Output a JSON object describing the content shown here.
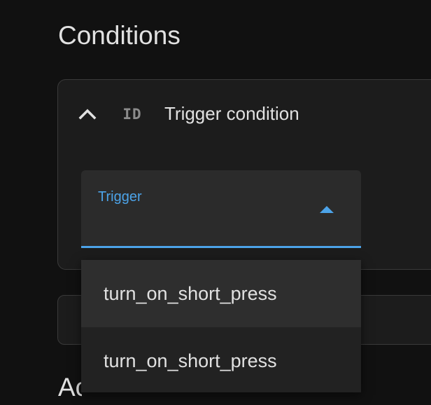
{
  "section": {
    "title": "Conditions",
    "next_title": "Actions"
  },
  "condition": {
    "collapse_icon": "chevron-up-icon",
    "type_icon": "id-icon",
    "type_icon_text": "ID",
    "title": "Trigger condition"
  },
  "trigger_select": {
    "label": "Trigger",
    "value": "",
    "arrow_icon": "triangle-up-icon",
    "options": [
      {
        "label": "turn_on_short_press",
        "highlighted": true
      },
      {
        "label": "turn_on_short_press",
        "highlighted": false
      }
    ]
  },
  "colors": {
    "background": "#111111",
    "card": "#1c1c1c",
    "field": "#2b2b2b",
    "menu": "#222222",
    "menu_highlight": "#2e2e2e",
    "accent": "#4ca3e8",
    "text": "#e1e1e1"
  }
}
